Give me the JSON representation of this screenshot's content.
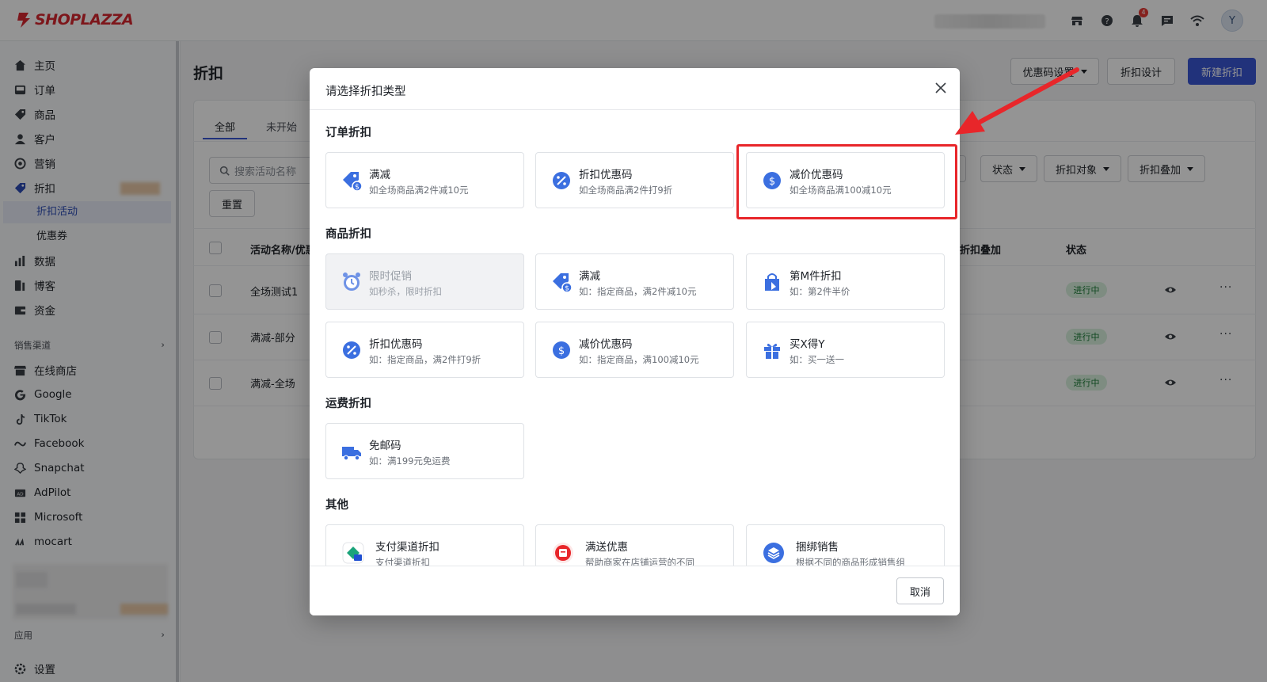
{
  "app": {
    "logo_text": "SHOPLAZZA",
    "notification_count": "4",
    "avatar_initial": "Y"
  },
  "sidebar": {
    "items": [
      {
        "label": "主页",
        "icon": "home-icon"
      },
      {
        "label": "订单",
        "icon": "inbox-icon"
      },
      {
        "label": "商品",
        "icon": "tag-icon"
      },
      {
        "label": "客户",
        "icon": "user-icon"
      },
      {
        "label": "营销",
        "icon": "target-icon"
      },
      {
        "label": "折扣",
        "icon": "discount-icon"
      }
    ],
    "sub_items": [
      {
        "label": "折扣活动"
      },
      {
        "label": "优惠券"
      }
    ],
    "items2": [
      {
        "label": "数据",
        "icon": "bar-chart-icon"
      },
      {
        "label": "博客",
        "icon": "blog-icon"
      },
      {
        "label": "资金",
        "icon": "wallet-icon"
      }
    ],
    "channels_title": "销售渠道",
    "channels": [
      {
        "label": "在线商店",
        "icon": "store-icon"
      },
      {
        "label": "Google",
        "icon": "google-icon"
      },
      {
        "label": "TikTok",
        "icon": "tiktok-icon"
      },
      {
        "label": "Facebook",
        "icon": "meta-icon"
      },
      {
        "label": "Snapchat",
        "icon": "snapchat-icon"
      },
      {
        "label": "AdPilot",
        "icon": "ad-icon"
      },
      {
        "label": "Microsoft",
        "icon": "microsoft-icon"
      },
      {
        "label": "mocart",
        "icon": "mocart-icon"
      }
    ],
    "apps_title": "应用",
    "settings": "设置"
  },
  "page": {
    "title": "折扣",
    "buttons": {
      "coupon_settings": "优惠码设置",
      "design": "折扣设计",
      "create": "新建折扣"
    },
    "tabs": [
      "全部",
      "未开始"
    ],
    "search_placeholder": "搜索活动名称",
    "reset": "重置",
    "filters": [
      "状态",
      "折扣对象",
      "折扣叠加"
    ],
    "columns": [
      "活动名称/优惠",
      "折扣叠加",
      "状态"
    ],
    "rows": [
      {
        "name": "全场测试1",
        "status": "进行中"
      },
      {
        "name": "满减-部分",
        "status": "进行中"
      },
      {
        "name": "满减-全场",
        "status": "进行中"
      }
    ],
    "more_glyph": "···"
  },
  "modal": {
    "title": "请选择折扣类型",
    "cancel": "取消",
    "sections": [
      {
        "title": "订单折扣",
        "options": [
          {
            "title": "满减",
            "desc": "如全场商品满2件减10元",
            "icon": "price-tag-dollar-icon"
          },
          {
            "title": "折扣优惠码",
            "desc": "如全场商品满2件打9折",
            "icon": "percent-badge-icon"
          },
          {
            "title": "减价优惠码",
            "desc": "如全场商品满100减10元",
            "icon": "dollar-badge-icon"
          }
        ]
      },
      {
        "title": "商品折扣",
        "options": [
          {
            "title": "限时促销",
            "desc": "如秒杀，限时折扣",
            "icon": "alarm-clock-icon",
            "disabled": true
          },
          {
            "title": "满减",
            "desc": "如：指定商品，满2件减10元",
            "icon": "price-tag-dollar-icon"
          },
          {
            "title": "第M件折扣",
            "desc": "如：第2件半价",
            "icon": "shopping-bag-icon"
          },
          {
            "title": "折扣优惠码",
            "desc": "如：指定商品，满2件打9折",
            "icon": "percent-badge-icon"
          },
          {
            "title": "减价优惠码",
            "desc": "如：指定商品，满100减10元",
            "icon": "dollar-badge-icon"
          },
          {
            "title": "买X得Y",
            "desc": "如：买一送一",
            "icon": "gift-icon"
          }
        ]
      },
      {
        "title": "运费折扣",
        "options": [
          {
            "title": "免邮码",
            "desc": "如：满199元免运费",
            "icon": "truck-icon"
          }
        ]
      },
      {
        "title": "其他",
        "options": [
          {
            "title": "支付渠道折扣",
            "desc": "支付渠道折扣",
            "icon": "payment-channel-icon"
          },
          {
            "title": "满送优惠",
            "desc": "帮助商家在店铺运营的不同",
            "icon": "red-coupon-icon"
          },
          {
            "title": "捆绑销售",
            "desc": "根据不同的商品形成销售组",
            "icon": "layers-icon"
          }
        ]
      }
    ]
  },
  "colors": {
    "brand": "#d8262f",
    "primary": "#3a56d4",
    "icon_blue": "#3b6fe0",
    "annotation": "#e8262a",
    "status_green": "#1b7a36"
  }
}
